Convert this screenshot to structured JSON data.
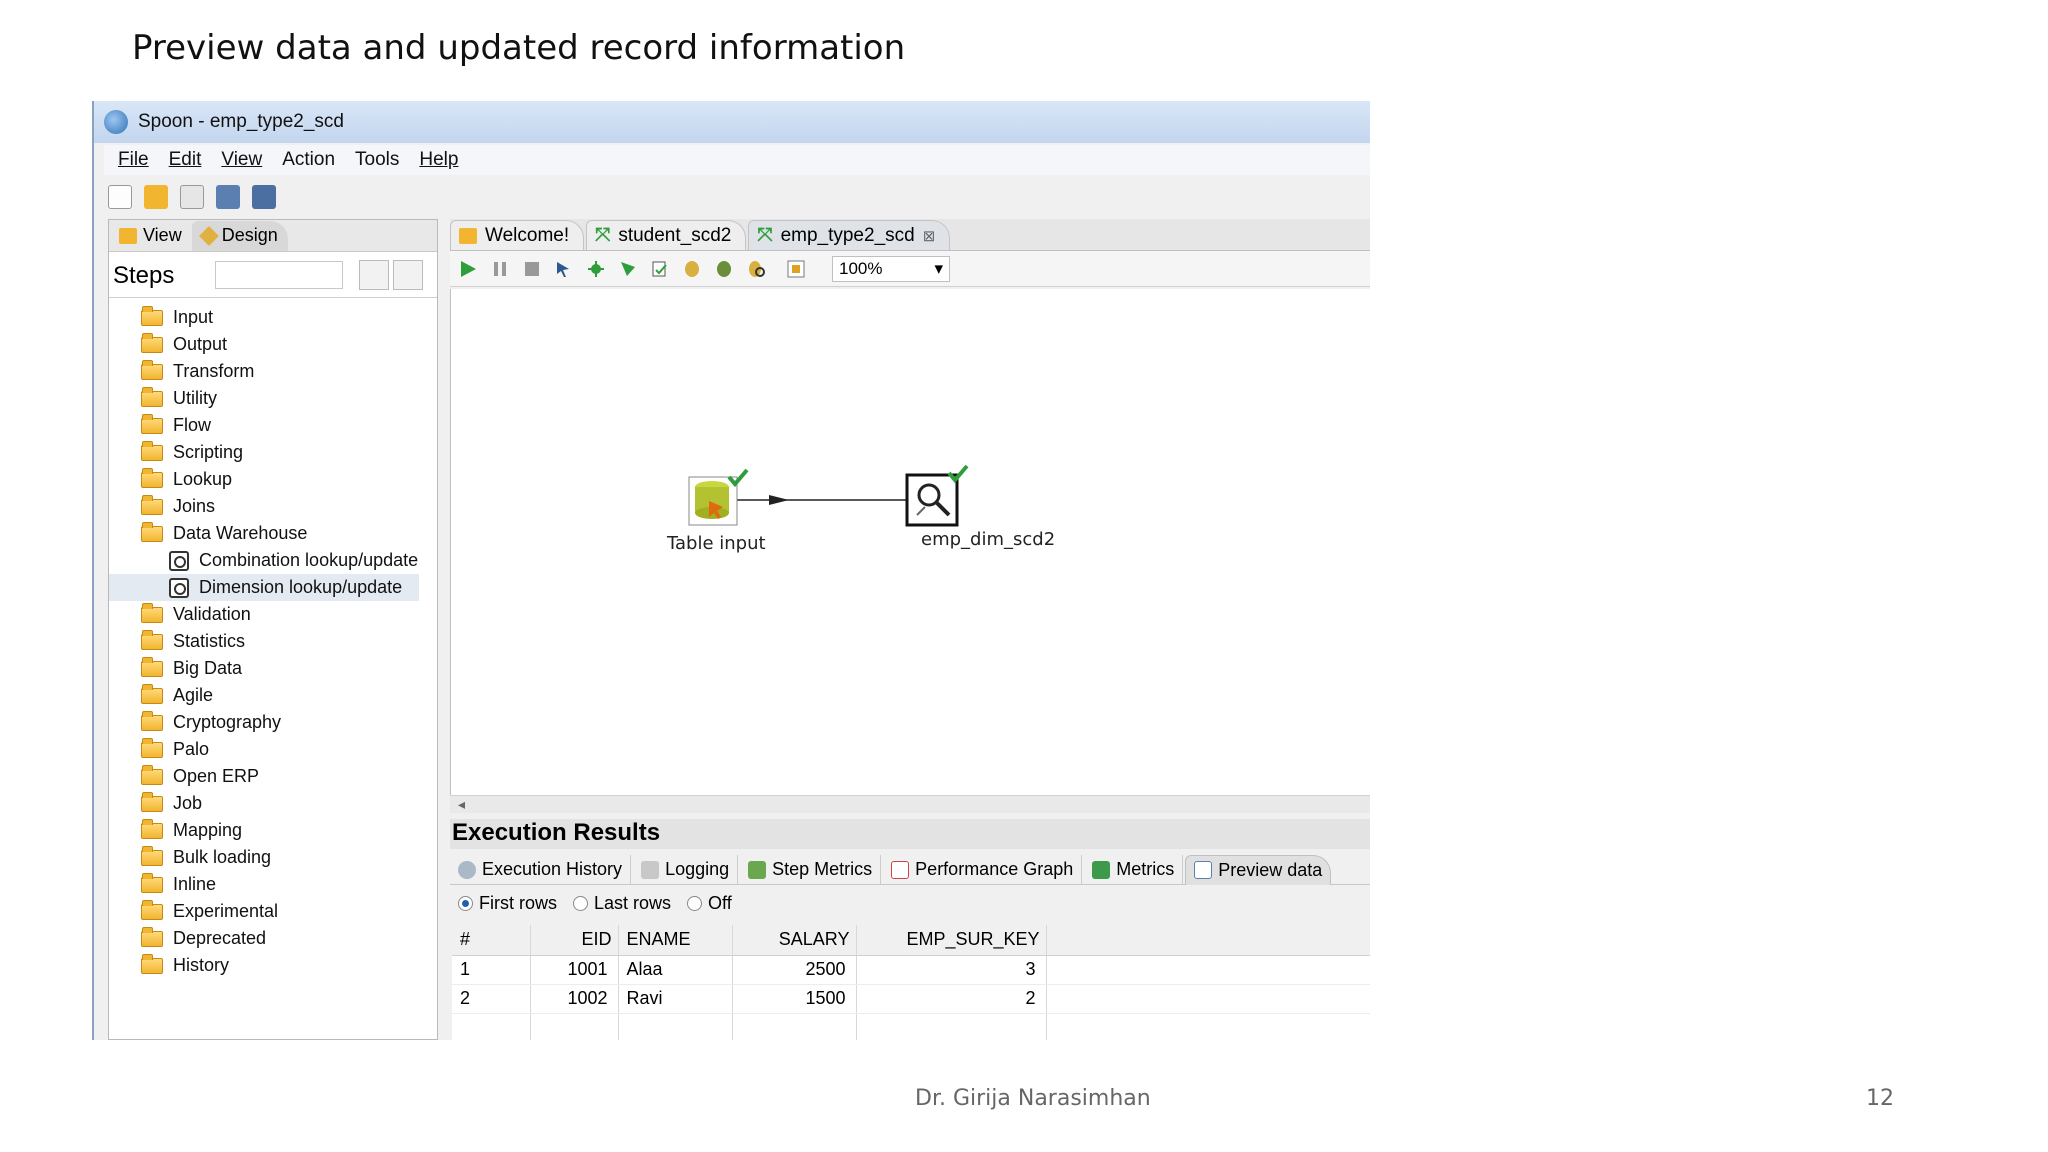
{
  "slide": {
    "title": "Preview data and updated record information",
    "footer": "Dr. Girija Narasimhan",
    "page_number": "12"
  },
  "window": {
    "title": "Spoon - emp_type2_scd",
    "menu": [
      "File",
      "Edit",
      "View",
      "Action",
      "Tools",
      "Help"
    ]
  },
  "left_panel": {
    "tabs": [
      "View",
      "Design"
    ],
    "steps_label": "Steps",
    "tree": [
      {
        "label": "Input",
        "type": "folder"
      },
      {
        "label": "Output",
        "type": "folder"
      },
      {
        "label": "Transform",
        "type": "folder"
      },
      {
        "label": "Utility",
        "type": "folder"
      },
      {
        "label": "Flow",
        "type": "folder"
      },
      {
        "label": "Scripting",
        "type": "folder"
      },
      {
        "label": "Lookup",
        "type": "folder"
      },
      {
        "label": "Joins",
        "type": "folder"
      },
      {
        "label": "Data Warehouse",
        "type": "folder"
      },
      {
        "label": "Combination lookup/update",
        "type": "step"
      },
      {
        "label": "Dimension lookup/update",
        "type": "step"
      },
      {
        "label": "Validation",
        "type": "folder"
      },
      {
        "label": "Statistics",
        "type": "folder"
      },
      {
        "label": "Big Data",
        "type": "folder"
      },
      {
        "label": "Agile",
        "type": "folder"
      },
      {
        "label": "Cryptography",
        "type": "folder"
      },
      {
        "label": "Palo",
        "type": "folder"
      },
      {
        "label": "Open ERP",
        "type": "folder"
      },
      {
        "label": "Job",
        "type": "folder"
      },
      {
        "label": "Mapping",
        "type": "folder"
      },
      {
        "label": "Bulk loading",
        "type": "folder"
      },
      {
        "label": "Inline",
        "type": "folder"
      },
      {
        "label": "Experimental",
        "type": "folder"
      },
      {
        "label": "Deprecated",
        "type": "folder"
      },
      {
        "label": "History",
        "type": "folder"
      }
    ]
  },
  "doc_tabs": [
    "Welcome!",
    "student_scd2",
    "emp_type2_scd"
  ],
  "zoom": "100%",
  "nodes": {
    "table_input": "Table input",
    "emp_dim": "emp_dim_scd2"
  },
  "execution": {
    "title": "Execution Results",
    "tabs": [
      "Execution History",
      "Logging",
      "Step Metrics",
      "Performance Graph",
      "Metrics",
      "Preview data"
    ],
    "radio_options": [
      "First rows",
      "Last rows",
      "Off"
    ],
    "selected_radio": "First rows",
    "columns": [
      "#",
      "EID",
      "ENAME",
      "SALARY",
      "EMP_SUR_KEY"
    ],
    "rows": [
      [
        "1",
        "1001",
        "Alaa",
        "2500",
        "3"
      ],
      [
        "2",
        "1002",
        "Ravi",
        "1500",
        "2"
      ]
    ]
  },
  "colors": {
    "titlebar": "#c3d6ee",
    "folder": "#f2b530",
    "check": "#2e9d3a",
    "accent": "#2060b0"
  }
}
